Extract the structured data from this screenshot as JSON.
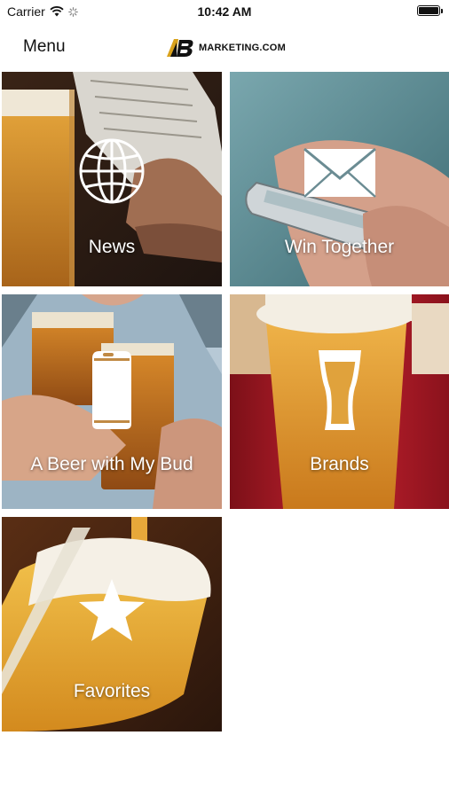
{
  "status_bar": {
    "carrier": "Carrier",
    "time": "10:42 AM",
    "battery_level": 1.0
  },
  "nav": {
    "menu_label": "Menu",
    "logo_text": "MARKETING.COM",
    "logo_mark": "AB"
  },
  "tiles": [
    {
      "label": "News",
      "icon": "globe-icon"
    },
    {
      "label": "Win Together",
      "icon": "envelope-icon"
    },
    {
      "label": "A Beer with My Bud",
      "icon": "beer-can-icon"
    },
    {
      "label": "Brands",
      "icon": "pint-glass-icon"
    },
    {
      "label": "Favorites",
      "icon": "star-icon"
    }
  ],
  "colors": {
    "beer_amber": "#d9901c",
    "foam": "#f4f0e6",
    "brand_red": "#b01a24",
    "teal_bg": "#5c8c94"
  }
}
